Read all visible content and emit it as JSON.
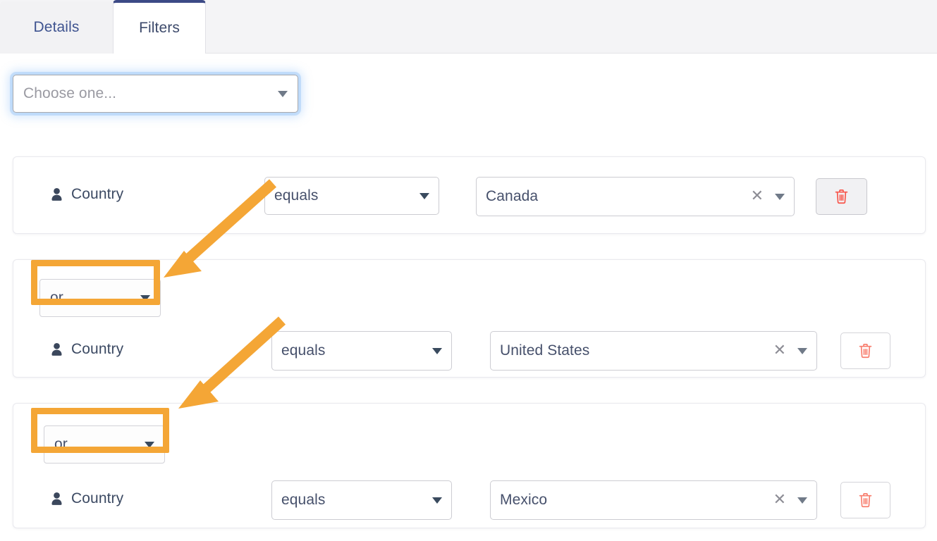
{
  "tabs": [
    {
      "id": "details",
      "label": "Details",
      "active": false
    },
    {
      "id": "filters",
      "label": "Filters",
      "active": true
    }
  ],
  "field_chooser": {
    "placeholder": "Choose one...",
    "value": "",
    "caret_icon": "chevron-down-icon",
    "focused": true
  },
  "filters": [
    {
      "operator": null,
      "field_icon": "person-icon",
      "field_label": "Country",
      "comparator": "equals",
      "comparator_caret": "chevron-down-icon",
      "value": "Canada",
      "clear_icon": "close-icon",
      "value_caret": "chevron-down-icon",
      "delete_icon": "trash-icon",
      "delete_hovered": true
    },
    {
      "operator": "or",
      "operator_caret": "chevron-down-icon",
      "operator_highlighted": true,
      "field_icon": "person-icon",
      "field_label": "Country",
      "comparator": "equals",
      "comparator_caret": "chevron-down-icon",
      "value": "United States",
      "clear_icon": "close-icon",
      "value_caret": "chevron-down-icon",
      "delete_icon": "trash-icon",
      "delete_hovered": false
    },
    {
      "operator": "or",
      "operator_caret": "chevron-down-icon",
      "operator_highlighted": true,
      "field_icon": "person-icon",
      "field_label": "Country",
      "comparator": "equals",
      "comparator_caret": "chevron-down-icon",
      "value": "Mexico",
      "clear_icon": "close-icon",
      "value_caret": "chevron-down-icon",
      "delete_icon": "trash-icon",
      "delete_hovered": false
    }
  ],
  "annotations": {
    "highlight_color": "#f4a636",
    "arrow_color": "#f4a636",
    "arrow_count": 2,
    "highlight_count": 2
  },
  "colors": {
    "active_tab_accent": "#3c4a86",
    "text_primary": "#3c4a63",
    "placeholder": "#9a9aa2",
    "trash_red": "#f8554a",
    "trash_salmon": "#f87e6e",
    "card_border": "#e9e9ee",
    "focus_glow": "#78b4f5"
  }
}
